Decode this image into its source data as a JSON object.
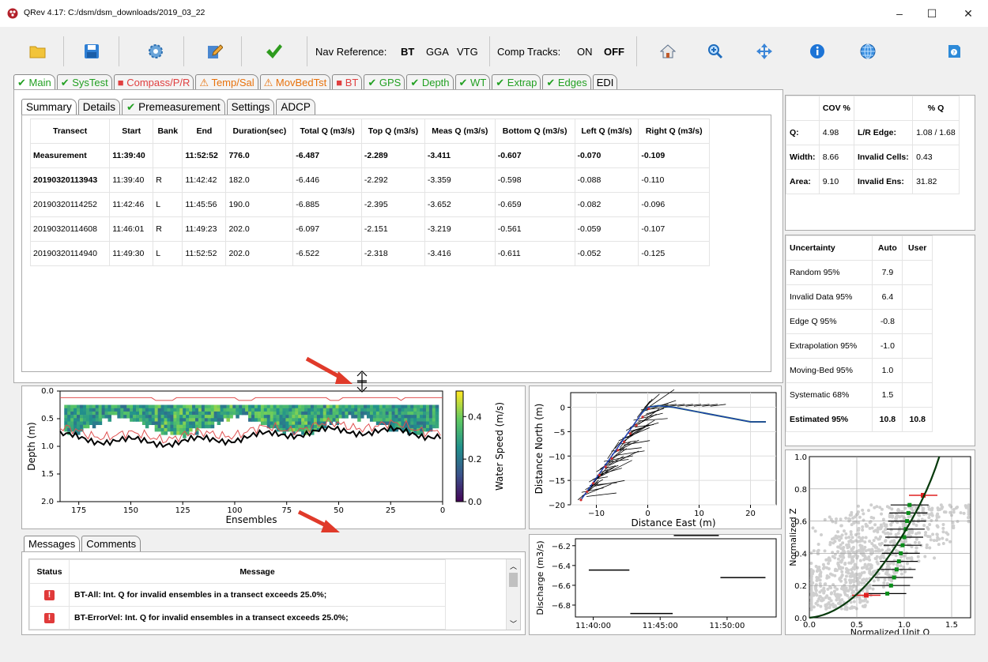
{
  "window": {
    "title": "QRev 4.17: C:/dsm/dsm_downloads/2019_03_22",
    "minimize": "–",
    "maximize": "☐",
    "close": "✕"
  },
  "toolbar": {
    "nav_label": "Nav Reference:",
    "nav_options": [
      "BT",
      "GGA",
      "VTG"
    ],
    "comp_label": "Comp Tracks:",
    "comp_options": [
      "ON",
      "OFF"
    ]
  },
  "main_tabs": [
    {
      "label": "Main",
      "status": "ok"
    },
    {
      "label": "SysTest",
      "status": "ok"
    },
    {
      "label": "Compass/P/R",
      "status": "bad"
    },
    {
      "label": "Temp/Sal",
      "status": "warn"
    },
    {
      "label": "MovBedTst",
      "status": "warn"
    },
    {
      "label": "BT",
      "status": "bad"
    },
    {
      "label": "GPS",
      "status": "ok"
    },
    {
      "label": "Depth",
      "status": "ok"
    },
    {
      "label": "WT",
      "status": "ok"
    },
    {
      "label": "Extrap",
      "status": "ok"
    },
    {
      "label": "Edges",
      "status": "ok"
    },
    {
      "label": "EDI",
      "status": "none"
    }
  ],
  "sub_tabs": [
    {
      "label": "Summary",
      "status": "none"
    },
    {
      "label": "Details",
      "status": "none"
    },
    {
      "label": "Premeasurement",
      "status": "ok"
    },
    {
      "label": "Settings",
      "status": "none"
    },
    {
      "label": "ADCP",
      "status": "none"
    }
  ],
  "summary": {
    "headers": [
      "Transect",
      "Start",
      "Bank",
      "End",
      "Duration(sec)",
      "Total Q (m3/s)",
      "Top Q (m3/s)",
      "Meas Q (m3/s)",
      "Bottom Q (m3/s)",
      "Left Q (m3/s)",
      "Right Q (m3/s)"
    ],
    "rows": [
      [
        "Measurement",
        "11:39:40",
        "",
        "11:52:52",
        "776.0",
        "-6.487",
        "-2.289",
        "-3.411",
        "-0.607",
        "-0.070",
        "-0.109"
      ],
      [
        "20190320113943",
        "11:39:40",
        "R",
        "11:42:42",
        "182.0",
        "-6.446",
        "-2.292",
        "-3.359",
        "-0.598",
        "-0.088",
        "-0.110"
      ],
      [
        "20190320114252",
        "11:42:46",
        "L",
        "11:45:56",
        "190.0",
        "-6.885",
        "-2.395",
        "-3.652",
        "-0.659",
        "-0.082",
        "-0.096"
      ],
      [
        "20190320114608",
        "11:46:01",
        "R",
        "11:49:23",
        "202.0",
        "-6.097",
        "-2.151",
        "-3.219",
        "-0.561",
        "-0.059",
        "-0.107"
      ],
      [
        "20190320114940",
        "11:49:30",
        "L",
        "11:52:52",
        "202.0",
        "-6.522",
        "-2.318",
        "-3.416",
        "-0.611",
        "-0.052",
        "-0.125"
      ]
    ]
  },
  "cov": {
    "headers": [
      "",
      "COV %",
      "",
      "% Q"
    ],
    "rows": [
      [
        "Q:",
        "4.98",
        "L/R Edge:",
        "1.08 /  1.68"
      ],
      [
        "Width:",
        "8.66",
        "Invalid Cells:",
        "0.43"
      ],
      [
        "Area:",
        "9.10",
        "Invalid Ens:",
        "31.82"
      ]
    ]
  },
  "uncertainty": {
    "headers": [
      "Uncertainty",
      "Auto",
      "User"
    ],
    "rows": [
      [
        "Random 95%",
        "7.9",
        ""
      ],
      [
        "Invalid Data 95%",
        "6.4",
        ""
      ],
      [
        "Edge Q 95%",
        "-0.8",
        ""
      ],
      [
        "Extrapolation 95%",
        "-1.0",
        ""
      ],
      [
        "Moving-Bed 95%",
        "1.0",
        ""
      ],
      [
        "Systematic 68%",
        "1.5",
        ""
      ],
      [
        "Estimated 95%",
        "10.8",
        "10.8"
      ]
    ]
  },
  "msg_tabs": [
    "Messages",
    "Comments"
  ],
  "messages": {
    "headers": [
      "Status",
      "Message"
    ],
    "rows": [
      {
        "text": "BT-All: Int. Q for invalid ensembles in a transect exceeds 25.0%;"
      },
      {
        "text": "BT-ErrorVel: Int. Q for invalid ensembles in a transect exceeds 25.0%;"
      }
    ]
  },
  "contour_chart": {
    "xlabel": "Ensembles",
    "ylabel": "Depth (m)",
    "cbar_label": "Water Speed (m/s)",
    "xticks": [
      "175",
      "150",
      "125",
      "100",
      "75",
      "50",
      "25",
      "0"
    ],
    "yticks": [
      "0.0",
      "0.5",
      "1.0",
      "1.5",
      "2.0"
    ],
    "cticks": [
      "0.4",
      "0.2",
      "0.0"
    ]
  },
  "chart_data": [
    {
      "type": "heatmap",
      "xlabel": "Ensembles",
      "ylabel": "Depth (m)",
      "xlim": [
        184,
        0
      ],
      "ylim": [
        2.0,
        0.0
      ],
      "colorbar": {
        "label": "Water Speed (m/s)",
        "range": [
          0,
          0.52
        ]
      },
      "bottom_depth_approx": [
        {
          "x": 184,
          "y": 0.8
        },
        {
          "x": 150,
          "y": 0.95
        },
        {
          "x": 100,
          "y": 1.05
        },
        {
          "x": 50,
          "y": 0.95
        },
        {
          "x": 0,
          "y": 0.85
        }
      ]
    },
    {
      "type": "line",
      "title": "",
      "xlabel": "Distance East (m)",
      "ylabel": "Distance North (m)",
      "xlim": [
        -15,
        25
      ],
      "ylim": [
        -20,
        3
      ],
      "xticks": [
        "−10",
        "0",
        "10",
        "20"
      ],
      "yticks": [
        "0",
        "−5",
        "−10",
        "−15",
        "−20"
      ],
      "series": [
        {
          "values": [
            [
              -13,
              -19
            ],
            [
              -9,
              -13
            ],
            [
              -5,
              -7
            ],
            [
              -1,
              -1
            ],
            [
              0,
              0
            ],
            [
              2,
              0.3
            ],
            [
              5,
              0
            ],
            [
              10,
              -1
            ],
            [
              15,
              -2
            ],
            [
              20,
              -3
            ],
            [
              23,
              -3
            ]
          ]
        }
      ]
    },
    {
      "type": "line",
      "xlabel": "",
      "ylabel": "Discharge (m3/s)",
      "xticks": [
        "11:40:00",
        "11:45:00",
        "11:50:00"
      ],
      "yticks": [
        "−6.2",
        "−6.4",
        "−6.6",
        "−6.8"
      ],
      "series": [
        {
          "values": [
            {
              "start": "11:39:40",
              "end": "11:42:42",
              "q": -6.446
            },
            {
              "start": "11:42:46",
              "end": "11:45:56",
              "q": -6.885
            },
            {
              "start": "11:46:01",
              "end": "11:49:23",
              "q": -6.097
            },
            {
              "start": "11:49:30",
              "end": "11:52:52",
              "q": -6.522
            }
          ]
        }
      ]
    },
    {
      "type": "scatter",
      "xlabel": "Normalized Unit Q",
      "ylabel": "Normalized Z",
      "xlim": [
        0,
        1.7
      ],
      "ylim": [
        0,
        1.0
      ],
      "xticks": [
        "0.0",
        "0.5",
        "1.0",
        "1.5"
      ],
      "yticks": [
        "0.0",
        "0.2",
        "0.4",
        "0.6",
        "0.8",
        "1.0"
      ]
    }
  ]
}
